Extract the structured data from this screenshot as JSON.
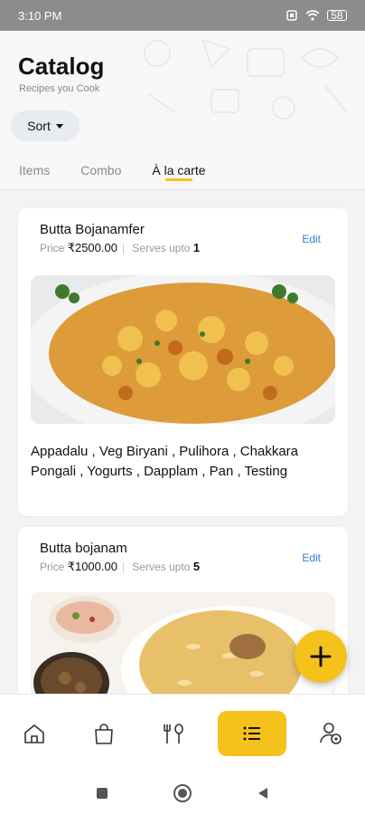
{
  "status": {
    "time": "3:10 PM",
    "battery": "58"
  },
  "header": {
    "title": "Catalog",
    "subtitle": "Recipes you Cook",
    "sort_label": "Sort"
  },
  "tabs": [
    {
      "label": "Items",
      "active": false
    },
    {
      "label": "Combo",
      "active": false
    },
    {
      "label": "À la carte",
      "active": true
    }
  ],
  "cards": [
    {
      "title": "Butta Bojanamfer",
      "price_label": "Price",
      "price": "₹2500.00",
      "serves_label": "Serves upto",
      "serves": "1",
      "edit_label": "Edit",
      "items": "Appadalu , Veg Biryani , Pulihora , Chakkara Pongali , Yogurts , Dapplam , Pan , Testing"
    },
    {
      "title": "Butta bojanam",
      "price_label": "Price",
      "price": "₹1000.00",
      "serves_label": "Serves upto",
      "serves": "5",
      "edit_label": "Edit"
    }
  ],
  "fab": {
    "icon": "plus-icon"
  },
  "bottom_nav": [
    {
      "icon": "home-icon"
    },
    {
      "icon": "shopping-bag-icon"
    },
    {
      "icon": "fork-spoon-icon"
    },
    {
      "icon": "list-icon",
      "active": true
    },
    {
      "icon": "user-settings-icon"
    }
  ],
  "colors": {
    "accent": "#f5c21b",
    "link": "#2f7fd3"
  }
}
